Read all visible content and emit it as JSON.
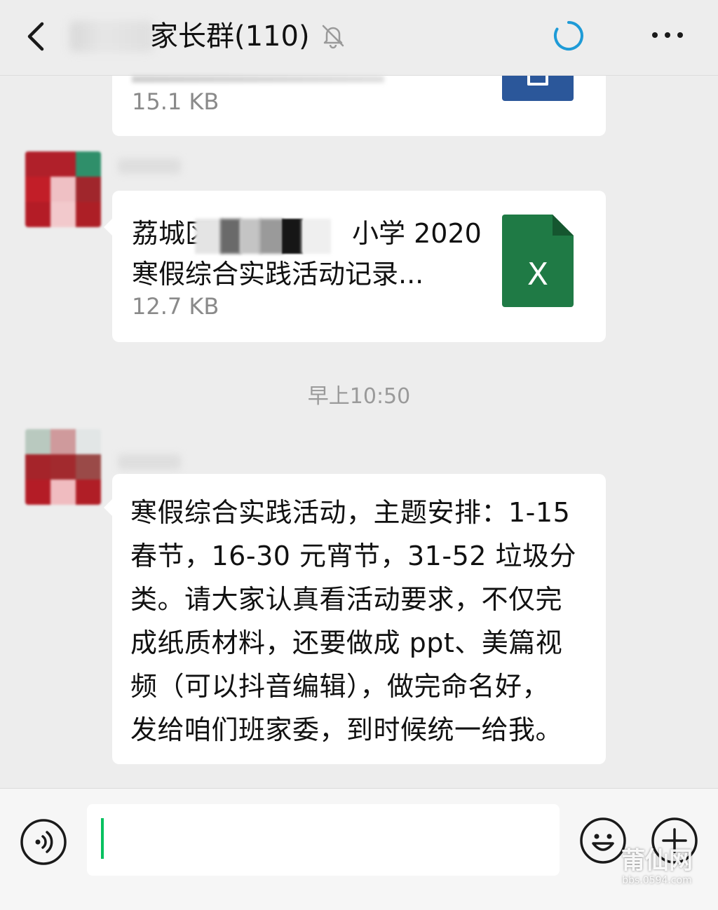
{
  "header": {
    "title": "家长群(110)",
    "back_icon": "chevron-left-icon",
    "mute_icon": "bell-off-icon",
    "status_icon": "loading-spinner-icon",
    "more_icon": "more-dots-icon",
    "status_color": "#1e9bd7"
  },
  "messages": [
    {
      "type": "file",
      "file_size": "15.1 KB",
      "file_icon": "word-file-icon",
      "icon_color": "#2b579a"
    },
    {
      "type": "file",
      "file_name_lines": [
        "荔城区",
        "小学 2020",
        "寒假综合实践活动记录..."
      ],
      "file_size": "12.7 KB",
      "file_icon": "excel-file-icon",
      "icon_color": "#1f7a45",
      "icon_letter": "X"
    },
    {
      "type": "timestamp",
      "text": "早上10:50"
    },
    {
      "type": "text",
      "lines": [
        "寒假综合实践活动，主题安排：1-15",
        "春节，16-30 元宵节，31-52 垃圾分",
        "类。请大家认真看活动要求，不仅完",
        "成纸质材料，还要做成 ppt、美篇视",
        "频（可以抖音编辑），做完命名好，",
        "发给咱们班家委，到时候统一给我。"
      ]
    }
  ],
  "input_bar": {
    "voice_icon": "voice-icon",
    "input_value": "",
    "emoji_icon": "emoji-icon",
    "plus_icon": "plus-icon",
    "caret_color": "#07c160"
  },
  "watermark": {
    "main": "莆仙网",
    "sub": "bbs.0594.com"
  }
}
